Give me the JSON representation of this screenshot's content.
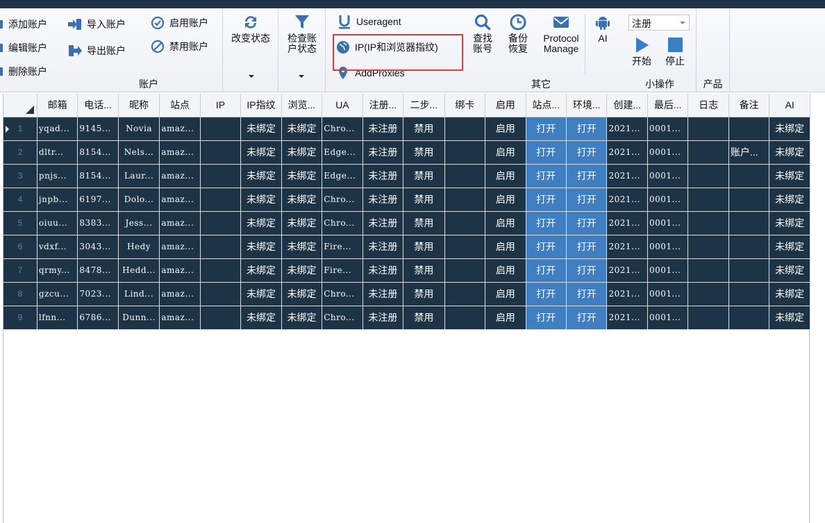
{
  "ribbon": {
    "account": {
      "label": "账户",
      "add": "添加账户",
      "edit": "编辑账户",
      "delete": "删除账户",
      "import": "导入账户",
      "export": "导出账户",
      "enable": "启用账户",
      "disable": "禁用账户"
    },
    "change_status": "改变状态",
    "check_status": "检查账户状态",
    "other": {
      "label": "其它",
      "useragent": "Useragent",
      "ip": "IP(IP和浏览器指纹)",
      "addproxies": "AddProxies",
      "find": "查找账号",
      "backup": "备份恢复",
      "protocol": "Protocol Manage",
      "ai": "AI"
    },
    "small_ops": {
      "label": "小操作",
      "combo_value": "注册",
      "start": "开始",
      "stop": "停止"
    },
    "product": {
      "label": "产品"
    }
  },
  "colors": {
    "accent": "#3f7fc1",
    "row_bg": "#1d3447",
    "highlight": "#e03a3a"
  },
  "grid": {
    "columns": [
      "邮箱",
      "电话...",
      "昵称",
      "站点",
      "IP",
      "IP指纹",
      "浏览...",
      "UA",
      "注册...",
      "二步...",
      "绑卡",
      "启用",
      "站点...",
      "环境...",
      "创建...",
      "最后...",
      "日志",
      "备注",
      "AI"
    ],
    "rows": [
      [
        "1",
        "yqad...",
        "9145...",
        "Novia",
        "amaz...",
        "",
        "未绑定",
        "未绑定",
        "Chro...",
        "未注册",
        "禁用",
        "",
        "启用",
        "打开",
        "打开",
        "2021...",
        "0001...",
        "",
        "",
        "未绑定"
      ],
      [
        "2",
        "dltr...",
        "8154...",
        "Nels...",
        "amaz...",
        "",
        "未绑定",
        "未绑定",
        "Edge...",
        "未注册",
        "禁用",
        "",
        "启用",
        "打开",
        "打开",
        "2021...",
        "0001...",
        "",
        "账户...",
        "未绑定"
      ],
      [
        "3",
        "pnjs...",
        "8154...",
        "Laur...",
        "amaz...",
        "",
        "未绑定",
        "未绑定",
        "Edge...",
        "未注册",
        "禁用",
        "",
        "启用",
        "打开",
        "打开",
        "2021...",
        "0001...",
        "",
        "",
        "未绑定"
      ],
      [
        "4",
        "jnpb...",
        "6197...",
        "Dolo...",
        "amaz...",
        "",
        "未绑定",
        "未绑定",
        "Chro...",
        "未注册",
        "禁用",
        "",
        "启用",
        "打开",
        "打开",
        "2021...",
        "0001...",
        "",
        "",
        "未绑定"
      ],
      [
        "5",
        "oiuu...",
        "8383...",
        "Jess...",
        "amaz...",
        "",
        "未绑定",
        "未绑定",
        "Chro...",
        "未注册",
        "禁用",
        "",
        "启用",
        "打开",
        "打开",
        "2021...",
        "0001...",
        "",
        "",
        "未绑定"
      ],
      [
        "6",
        "vdxf...",
        "3043...",
        "Hedy",
        "amaz...",
        "",
        "未绑定",
        "未绑定",
        "Fire...",
        "未注册",
        "禁用",
        "",
        "启用",
        "打开",
        "打开",
        "2021...",
        "0001...",
        "",
        "",
        "未绑定"
      ],
      [
        "7",
        "qrmy...",
        "8478...",
        "Hedd...",
        "amaz...",
        "",
        "未绑定",
        "未绑定",
        "Fire...",
        "未注册",
        "禁用",
        "",
        "启用",
        "打开",
        "打开",
        "2021...",
        "0001...",
        "",
        "",
        "未绑定"
      ],
      [
        "8",
        "gzcu...",
        "7023...",
        "Lind...",
        "amaz...",
        "",
        "未绑定",
        "未绑定",
        "Chro...",
        "未注册",
        "禁用",
        "",
        "启用",
        "打开",
        "打开",
        "2021...",
        "0001...",
        "",
        "",
        "未绑定"
      ],
      [
        "9",
        "lfnn...",
        "6786...",
        "Dunn...",
        "amaz...",
        "",
        "未绑定",
        "未绑定",
        "Chro...",
        "未注册",
        "禁用",
        "",
        "启用",
        "打开",
        "打开",
        "2021...",
        "0001...",
        "",
        "",
        "未绑定"
      ]
    ]
  }
}
